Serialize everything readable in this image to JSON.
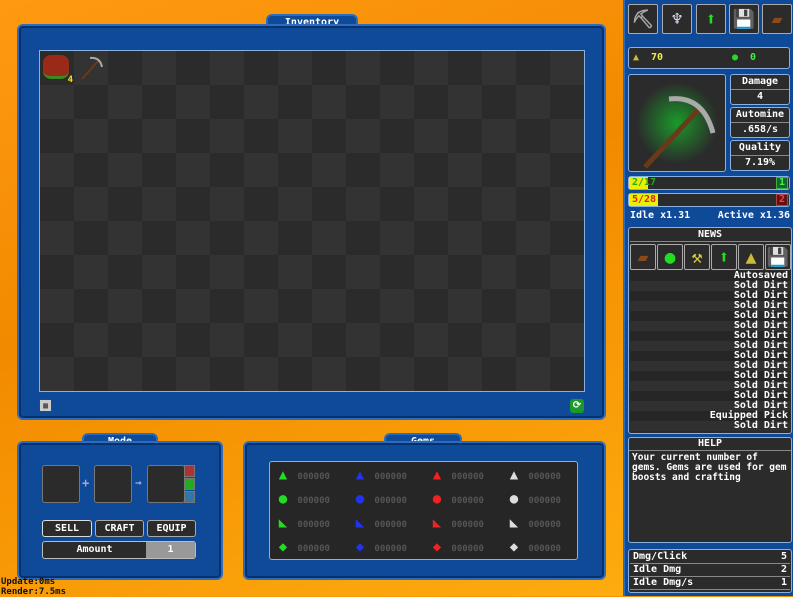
{
  "inventory": {
    "title": "Inventory",
    "items": [
      {
        "name": "Dirt",
        "count": "4",
        "icon": "dirt-block-icon"
      },
      {
        "name": "Pickaxe",
        "icon": "pickaxe-icon"
      }
    ]
  },
  "mode": {
    "title": "Mode",
    "sell": "SELL",
    "craft": "CRAFT",
    "equip": "EQUIP",
    "amount_label": "Amount",
    "amount_value": "1"
  },
  "gems": {
    "title": "Gems",
    "rows": [
      [
        {
          "color": "#22dd22",
          "shape": "▲",
          "value": "000000"
        },
        {
          "color": "#2233ee",
          "shape": "▲",
          "value": "000000"
        },
        {
          "color": "#ee2222",
          "shape": "▲",
          "value": "000000"
        },
        {
          "color": "#dddddd",
          "shape": "▲",
          "value": "000000"
        }
      ],
      [
        {
          "color": "#22dd22",
          "shape": "●",
          "value": "000000"
        },
        {
          "color": "#2233ee",
          "shape": "●",
          "value": "000000"
        },
        {
          "color": "#ee2222",
          "shape": "●",
          "value": "000000"
        },
        {
          "color": "#dddddd",
          "shape": "●",
          "value": "000000"
        }
      ],
      [
        {
          "color": "#22dd22",
          "shape": "◣",
          "value": "000000"
        },
        {
          "color": "#2233ee",
          "shape": "◣",
          "value": "000000"
        },
        {
          "color": "#ee2222",
          "shape": "◣",
          "value": "000000"
        },
        {
          "color": "#dddddd",
          "shape": "◣",
          "value": "000000"
        }
      ],
      [
        {
          "color": "#22dd22",
          "shape": "◆",
          "value": "000000"
        },
        {
          "color": "#2233ee",
          "shape": "◆",
          "value": "000000"
        },
        {
          "color": "#ee2222",
          "shape": "◆",
          "value": "000000"
        },
        {
          "color": "#dddddd",
          "shape": "◆",
          "value": "000000"
        }
      ]
    ]
  },
  "debug": {
    "update": "Update:0ms",
    "render": "Render:7.5ms"
  },
  "sidebar": {
    "gold": "70",
    "gems": "0",
    "damage_label": "Damage",
    "damage": "4",
    "automine_label": "Automine",
    "automine": ".658/s",
    "quality_label": "Quality",
    "quality": "7.19%",
    "xp_bar": {
      "text": "2/17",
      "level": "1",
      "fraction": 0.118
    },
    "hp_bar": {
      "text": "5/28",
      "level": "2",
      "fraction": 0.179
    },
    "idle": "Idle x1.31",
    "active": "Active x1.36",
    "news_title": "NEWS",
    "news": [
      "Autosaved",
      "Sold Dirt",
      "Sold Dirt",
      "Sold Dirt",
      "Sold Dirt",
      "Sold Dirt",
      "Sold Dirt",
      "Sold Dirt",
      "Sold Dirt",
      "Sold Dirt",
      "Sold Dirt",
      "Sold Dirt",
      "Sold Dirt",
      "Sold Dirt",
      "Equipped Pick",
      "Sold Dirt"
    ],
    "help_title": "HELP",
    "help_text": "Your current number of gems. Gems are used for gem boosts and crafting",
    "stats": [
      {
        "label": "Dmg/Click",
        "value": "5"
      },
      {
        "label": "Idle Dmg",
        "value": "2"
      },
      {
        "label": "Idle Dmg/s",
        "value": "1"
      }
    ]
  }
}
